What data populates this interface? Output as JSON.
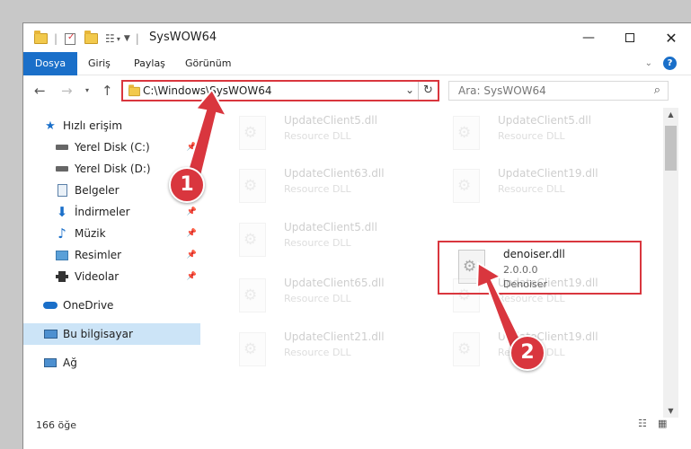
{
  "window": {
    "title": "SysWOW64"
  },
  "ribbon": {
    "tabs": [
      "Dosya",
      "Giriş",
      "Paylaş",
      "Görünüm"
    ],
    "help_label": "?"
  },
  "address": {
    "path": "C:\\Windows\\SysWOW64"
  },
  "search": {
    "placeholder": "Ara: SysWOW64"
  },
  "sidebar": {
    "items": [
      {
        "label": "Hızlı erişim",
        "icon": "star-icon"
      },
      {
        "label": "Yerel Disk (C:)",
        "icon": "drive-icon"
      },
      {
        "label": "Yerel Disk (D:)",
        "icon": "drive-icon"
      },
      {
        "label": "Belgeler",
        "icon": "document-icon"
      },
      {
        "label": "İndirmeler",
        "icon": "download-icon"
      },
      {
        "label": "Müzik",
        "icon": "music-icon"
      },
      {
        "label": "Resimler",
        "icon": "pictures-icon"
      },
      {
        "label": "Videolar",
        "icon": "video-icon"
      },
      {
        "label": "OneDrive",
        "icon": "cloud-icon"
      },
      {
        "label": "Bu bilgisayar",
        "icon": "computer-icon"
      },
      {
        "label": "Ağ",
        "icon": "network-icon"
      }
    ]
  },
  "files": [
    {
      "name": "UpdateClient5.dll",
      "line2": "Resource DLL",
      "line3": ""
    },
    {
      "name": "UpdateClient5.dll",
      "line2": "Resource DLL",
      "line3": ""
    },
    {
      "name": "UpdateClient63.dll",
      "line2": "Resource DLL",
      "line3": ""
    },
    {
      "name": "UpdateClient19.dll",
      "line2": "Resource DLL",
      "line3": ""
    },
    {
      "name": "UpdateClient5.dll",
      "line2": "Resource DLL",
      "line3": ""
    },
    {
      "name": "denoiser.dll",
      "line2": "2.0.0.0",
      "line3": "Denoiser"
    },
    {
      "name": "UpdateClient65.dll",
      "line2": "Resource DLL",
      "line3": ""
    },
    {
      "name": "UpdateClient19.dll",
      "line2": "Resource DLL",
      "line3": ""
    },
    {
      "name": "UpdateClient21.dll",
      "line2": "Resource DLL",
      "line3": ""
    },
    {
      "name": "UpdateClient19.dll",
      "line2": "Resource DLL",
      "line3": ""
    }
  ],
  "status": {
    "count": "166 öğe"
  },
  "annotations": {
    "badge1": "1",
    "badge2": "2"
  },
  "colors": {
    "accent": "#1a6fc9",
    "annotation_red": "#d9363e",
    "selection": "#cce4f7"
  }
}
